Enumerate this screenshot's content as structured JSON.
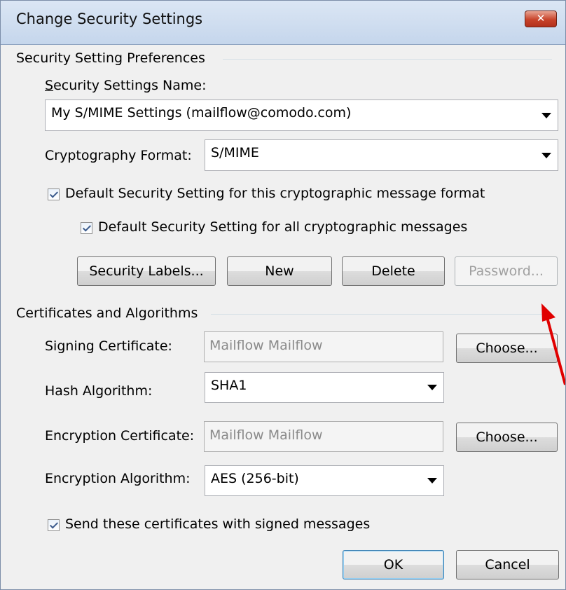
{
  "window": {
    "title": "Change Security Settings",
    "close_label": "✕"
  },
  "preferences": {
    "heading": "Security Setting Preferences",
    "name_label": "Security Settings Name:",
    "name_value": "My S/MIME Settings (mailflow@comodo.com)",
    "format_label": "Cryptography Format:",
    "format_value": "S/MIME",
    "default_format_label": "Default Security Setting for this cryptographic message format",
    "default_all_label": "Default Security Setting for all cryptographic messages",
    "buttons": {
      "security_labels": "Security Labels...",
      "new": "New",
      "delete": "Delete",
      "password": "Password..."
    }
  },
  "certificates": {
    "heading": "Certificates and Algorithms",
    "signing_label": "Signing Certificate:",
    "signing_value": "Mailflow Mailflow",
    "choose_label": "Choose...",
    "hash_label": "Hash Algorithm:",
    "hash_value": "SHA1",
    "encryption_cert_label": "Encryption Certificate:",
    "encryption_cert_value": "Mailflow Mailflow",
    "encryption_alg_label": "Encryption Algorithm:",
    "encryption_alg_value": "AES (256-bit)",
    "send_certs_label": "Send these certificates with signed messages"
  },
  "footer": {
    "ok": "OK",
    "cancel": "Cancel"
  },
  "colors": {
    "annotation_arrow": "#e00000"
  }
}
